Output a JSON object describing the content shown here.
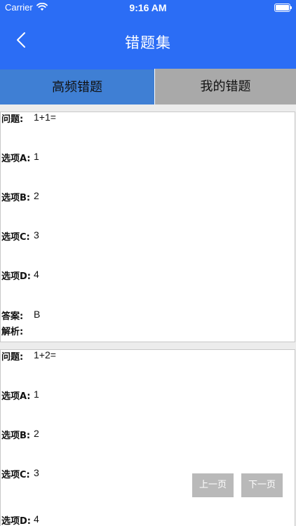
{
  "status_bar": {
    "carrier": "Carrier",
    "time": "9:16 AM"
  },
  "nav": {
    "title": "错题集"
  },
  "tabs": [
    {
      "label": "高频错题",
      "active": true
    },
    {
      "label": "我的错题",
      "active": false
    }
  ],
  "labels": {
    "question": "问题:",
    "option_a": "选项A:",
    "option_b": "选项B:",
    "option_c": "选项C:",
    "option_d": "选项D:",
    "answer": "答案:",
    "analysis": "解析:"
  },
  "questions": [
    {
      "question": "1+1=",
      "option_a": "1",
      "option_b": "2",
      "option_c": "3",
      "option_d": "4",
      "answer": "B",
      "analysis": ""
    },
    {
      "question": "1+2=",
      "option_a": "1",
      "option_b": "2",
      "option_c": "3",
      "option_d": "4"
    }
  ],
  "pager": {
    "prev_label": "上一页",
    "next_label": "下一页"
  },
  "colors": {
    "nav_blue": "#2b6df5",
    "tab_active": "#3f7fd4",
    "tab_inactive": "#a9a9a9",
    "pager_button": "#b9b9b9"
  },
  "icons": {
    "back": "chevron-left-icon",
    "wifi": "wifi-icon",
    "battery": "battery-icon"
  }
}
